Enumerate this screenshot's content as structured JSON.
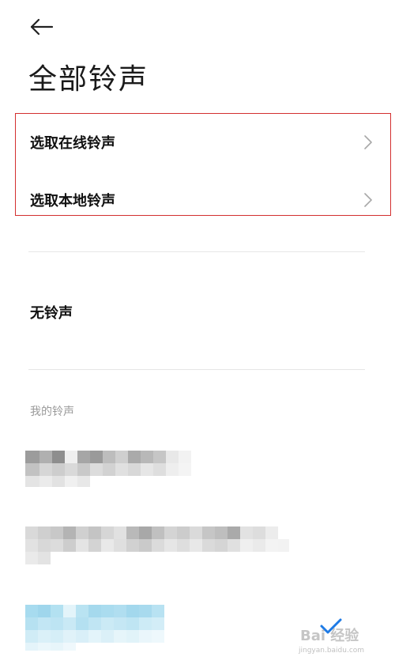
{
  "header": {
    "back_icon": "arrow-left-icon",
    "title": "全部铃声"
  },
  "online_option": {
    "label": "选取在线铃声",
    "chevron_icon": "chevron-right-icon"
  },
  "local_option": {
    "label": "选取本地铃声",
    "chevron_icon": "chevron-right-icon"
  },
  "no_ringtone": {
    "label": "无铃声"
  },
  "my_ringtones": {
    "header": "我的铃声",
    "items": [
      {
        "name": "",
        "blurred": true,
        "selected": false
      },
      {
        "name": "",
        "blurred": true,
        "selected": false
      },
      {
        "name": "",
        "blurred": true,
        "selected": true
      }
    ]
  },
  "selected_icon": "checkmark-icon",
  "colors": {
    "accent": "#1e7be6",
    "highlight_border": "#d32f2f",
    "divider": "#e6e6e6",
    "section_header": "#9a9a9a"
  },
  "watermark": {
    "text": "Bai 经验",
    "sub": "jingyan.baidu.com"
  }
}
